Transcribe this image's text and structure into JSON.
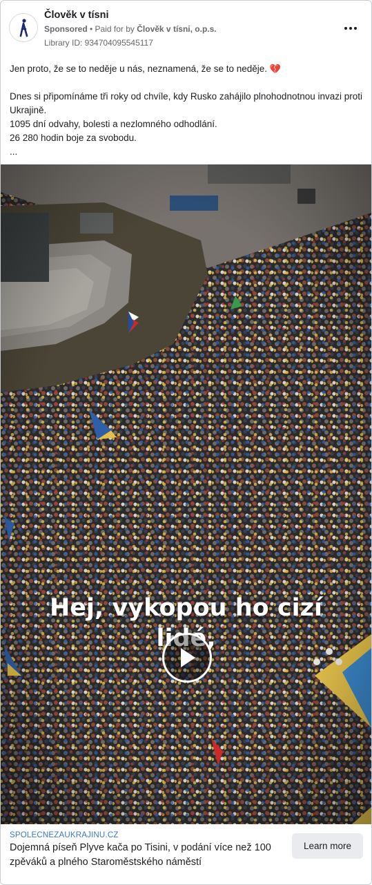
{
  "ad": {
    "page_name": "Člověk v tísni",
    "sponsored_label": "Sponsored",
    "separator": " • ",
    "paid_for_prefix": "Paid for by ",
    "payer": "Člověk v tísni, o.p.s.",
    "library_id": "Library ID: 934704095545117",
    "avatar_icon": "person-logo-icon",
    "more_icon": "more-options-icon"
  },
  "post": {
    "line1": "Jen proto, že se to neděje u nás, neznamená, že se to neděje.",
    "line1_emoji": "💔",
    "line2": "Dnes si připomínáme tři roky od chvíle, kdy Rusko zahájilo plnohodnotnou invazi proti Ukrajině.",
    "line3": "1095 dní odvahy, bolesti a nezlomného odhodlání.",
    "line4": "26 280 hodin boje za svobodu.",
    "ellipsis": "..."
  },
  "video": {
    "caption_line1": "Hej, vykopou ho cizí",
    "caption_line2": "lidé,",
    "play_icon": "play-icon"
  },
  "link": {
    "domain": "SPOLECNEZAUKRAJINU.CZ",
    "headline": "Dojemná píseň Plyve kača po Tisini, v podání více než 100 zpěváků a plného Staroměstského náměstí",
    "cta_label": "Learn more"
  },
  "colors": {
    "link_domain": "#3a76c2",
    "cta_background": "#e9ebee",
    "text_primary": "#1c1e21",
    "text_secondary": "#65676b"
  }
}
